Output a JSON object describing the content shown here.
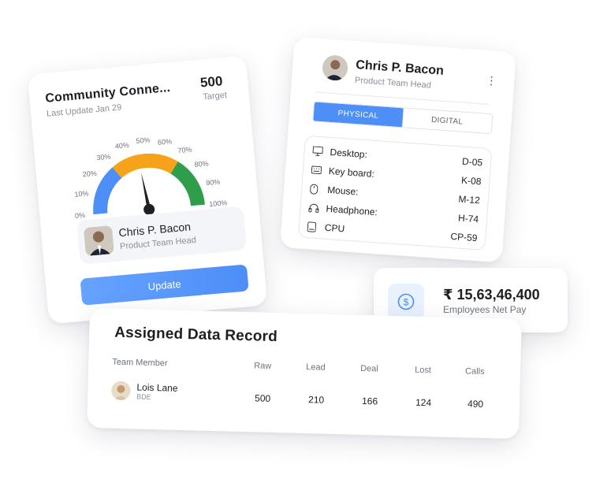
{
  "gauge_card": {
    "title": "Community Conne...",
    "subtitle": "Last Update Jan 29",
    "target_value": "500",
    "target_label": "Target",
    "gauge": {
      "ticks": [
        "0%",
        "10%",
        "20%",
        "30%",
        "40%",
        "50%",
        "60%",
        "70%",
        "80%",
        "90%",
        "100%"
      ],
      "needle_fraction": 0.46,
      "segments": [
        {
          "color": "#4d8ef7"
        },
        {
          "color": "#f7a21b"
        },
        {
          "color": "#2e9e4a"
        }
      ]
    },
    "profile": {
      "name": "Chris P. Bacon",
      "role": "Product Team Head"
    },
    "update_label": "Update"
  },
  "devices_card": {
    "name": "Chris P. Bacon",
    "role": "Product Team Head",
    "tabs": [
      {
        "label": "PHYSICAL",
        "active": true
      },
      {
        "label": "DIGITAL",
        "active": false
      }
    ],
    "devices": [
      {
        "icon": "desktop-icon",
        "label": "Desktop:",
        "code": "D-05"
      },
      {
        "icon": "keyboard-icon",
        "label": "Key board:",
        "code": "K-08"
      },
      {
        "icon": "mouse-icon",
        "label": "Mouse:",
        "code": "M-12"
      },
      {
        "icon": "headphone-icon",
        "label": "Headphone:",
        "code": "H-74"
      },
      {
        "icon": "cpu-icon",
        "label": "CPU",
        "code": "CP-59"
      }
    ]
  },
  "pay_card": {
    "amount": "₹ 15,63,46,400",
    "label": "Employees Net Pay",
    "icon": "dollar-coin-icon"
  },
  "table_card": {
    "title": "Assigned Data Record",
    "columns": [
      "Team Member",
      "Raw",
      "Lead",
      "Deal",
      "Lost",
      "Calls"
    ],
    "rows": [
      {
        "name": "Lois Lane",
        "role": "BDE",
        "raw": "500",
        "lead": "210",
        "deal": "166",
        "lost": "124",
        "calls": "490"
      }
    ]
  },
  "colors": {
    "accent": "#4d8ef7"
  }
}
